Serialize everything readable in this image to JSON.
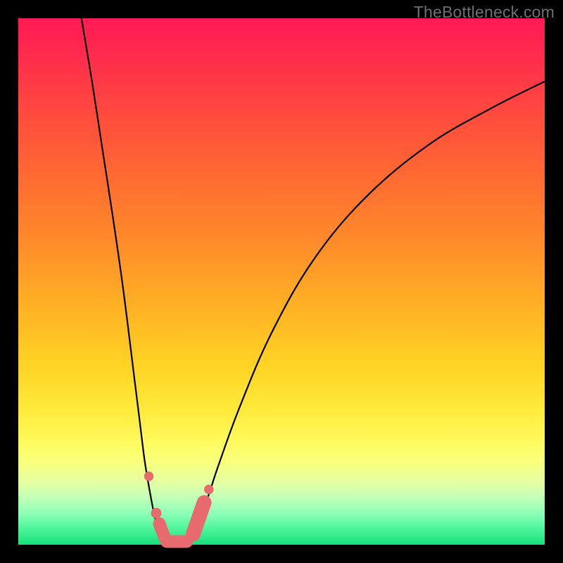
{
  "watermark": "TheBottleneck.com",
  "chart_data": {
    "type": "line",
    "title": "",
    "xlabel": "",
    "ylabel": "",
    "xlim": [
      0,
      100
    ],
    "ylim": [
      0,
      100
    ],
    "grid": false,
    "legend": false,
    "series": [
      {
        "name": "left-branch",
        "x": [
          12,
          14,
          16,
          18,
          20,
          22,
          23,
          24,
          25,
          26,
          27,
          28
        ],
        "y": [
          100,
          88,
          75,
          62,
          48,
          32,
          24,
          16,
          10,
          5,
          2,
          0
        ]
      },
      {
        "name": "right-branch",
        "x": [
          32,
          34,
          36,
          38,
          42,
          48,
          56,
          66,
          78,
          90,
          100
        ],
        "y": [
          0,
          4,
          9,
          15,
          26,
          40,
          54,
          66,
          76,
          83,
          88
        ]
      }
    ],
    "markers": [
      {
        "name": "dot-left-upper",
        "x": 24.8,
        "y": 13.0,
        "r": 0.9
      },
      {
        "name": "dot-left-lower",
        "x": 26.2,
        "y": 6.0,
        "r": 1.0
      },
      {
        "name": "pill-left",
        "x0": 26.8,
        "y0": 4.0,
        "x1": 27.8,
        "y1": 1.3,
        "r": 1.2
      },
      {
        "name": "pill-bottom",
        "x0": 28.2,
        "y0": 0.6,
        "x1": 32.0,
        "y1": 0.6,
        "r": 1.2
      },
      {
        "name": "pill-right",
        "x0": 33.2,
        "y0": 2.0,
        "x1": 35.3,
        "y1": 8.0,
        "r": 1.4
      },
      {
        "name": "dot-right-upper",
        "x": 36.2,
        "y": 10.5,
        "r": 0.9
      }
    ],
    "marker_color": "#e76a6f"
  }
}
